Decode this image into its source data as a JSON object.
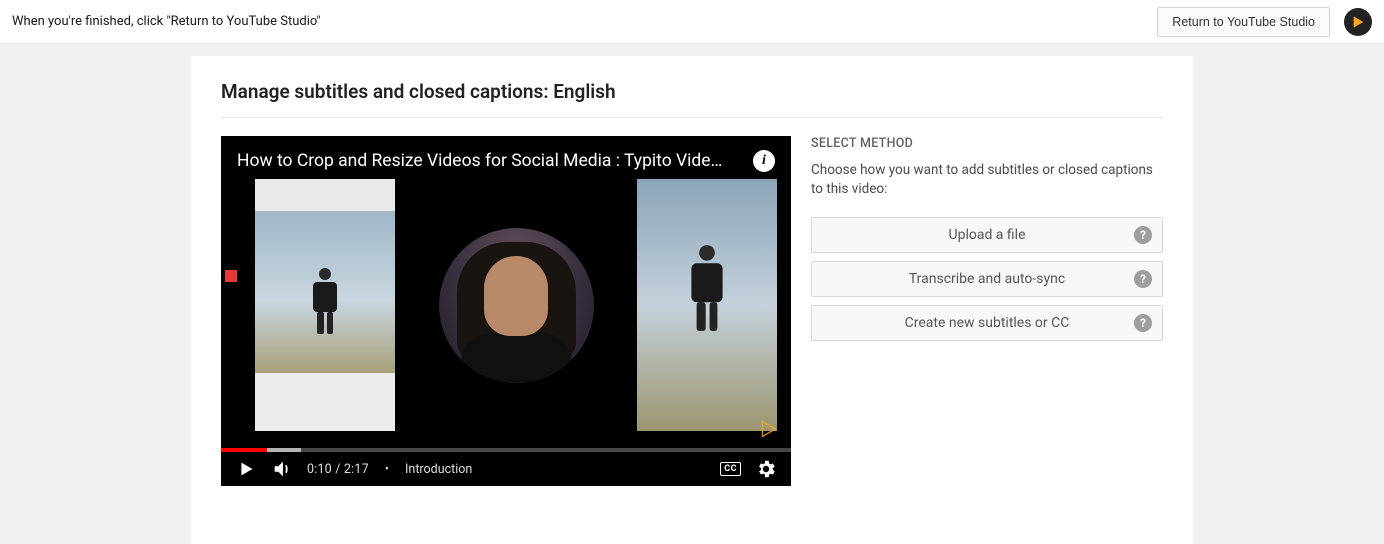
{
  "topbar": {
    "instruction": "When you're finished, click \"Return to YouTube Studio\"",
    "return_label": "Return to YouTube Studio"
  },
  "page": {
    "title": "Manage subtitles and closed captions: English"
  },
  "player": {
    "video_title": "How to Crop and Resize Videos for Social Media : Typito Vide…",
    "current_time": "0:10",
    "duration": "2:17",
    "separator": "/",
    "chapter_bullet": "•",
    "chapter": "Introduction",
    "cc_label": "CC"
  },
  "method_panel": {
    "heading": "SELECT METHOD",
    "description": "Choose how you want to add subtitles or closed captions to this video:",
    "options": [
      {
        "label": "Upload a file"
      },
      {
        "label": "Transcribe and auto-sync"
      },
      {
        "label": "Create new subtitles or CC"
      }
    ],
    "help_glyph": "?"
  }
}
